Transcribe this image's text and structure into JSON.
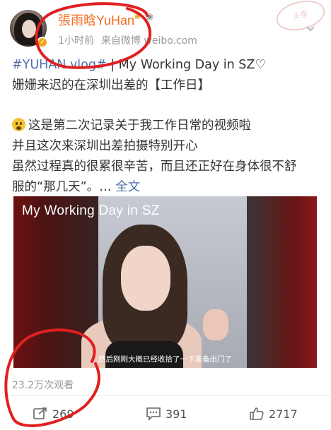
{
  "header": {
    "username": "張雨晗YuHan",
    "timestamp": "1小时前",
    "source": "来自微博 weibo.com",
    "stamp_text": "头条",
    "badge_icon": "verified-icon",
    "crown_icon": "crown-icon",
    "member_icon": "member-icon"
  },
  "post": {
    "hashtag": "#YUHAN vlog#",
    "line1_rest": " | My Working Day in SZ♡",
    "line2": "姗姗来迟的在深圳出差的【工作日】",
    "line3": "这是第二次记录关于我工作日常的视频啦",
    "line4": "并且这次来深圳出差拍摄特别开心",
    "line5": "虽然过程真的很累很辛苦，而且还正好在身体很不舒",
    "line6_text": "服的“那几天”。… ",
    "full_text_link": "全文"
  },
  "video": {
    "title": "My Working Day in SZ",
    "subtitle": "然后刚刚大概已经收拾了一下准备出门了",
    "views": "23.2万次观看"
  },
  "actions": {
    "repost_count": "269",
    "comment_count": "391",
    "like_count": "2717"
  },
  "colors": {
    "accent_orange": "#f26d22",
    "link_blue": "#4f6ea8",
    "annotation_red": "#e02020"
  }
}
